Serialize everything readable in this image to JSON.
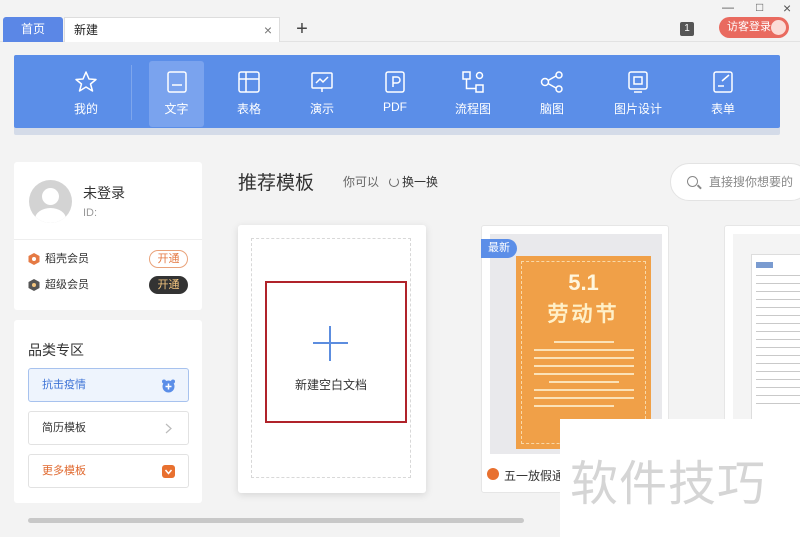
{
  "tabs": {
    "home": "首页",
    "new": "新建",
    "close": "×",
    "add": "+"
  },
  "top_right": {
    "badge": "1",
    "login": "访客登录",
    "minimize": "—",
    "maximize": "□",
    "close": "×"
  },
  "toolbar": [
    {
      "label": "我的",
      "icon": "star-icon"
    },
    {
      "label": "文字",
      "icon": "document-icon",
      "active": true
    },
    {
      "label": "表格",
      "icon": "table-icon"
    },
    {
      "label": "演示",
      "icon": "presentation-icon"
    },
    {
      "label": "PDF",
      "icon": "pdf-icon"
    },
    {
      "label": "流程图",
      "icon": "flowchart-icon"
    },
    {
      "label": "脑图",
      "icon": "mindmap-icon"
    },
    {
      "label": "图片设计",
      "icon": "image-design-icon"
    },
    {
      "label": "表单",
      "icon": "form-icon"
    }
  ],
  "user": {
    "name": "未登录",
    "id": "ID:",
    "memberships": [
      {
        "label": "稻壳会员",
        "button": "开通",
        "color": "#e57a44"
      },
      {
        "label": "超级会员",
        "button": "开通",
        "color": "#333333"
      }
    ]
  },
  "categories": {
    "title": "品类专区",
    "items": [
      "抗击疫情",
      "简历模板",
      "更多模板"
    ]
  },
  "section": {
    "title": "推荐模板",
    "subtitle": "你可以",
    "refresh": "换一换",
    "search_placeholder": "直接搜你想要的"
  },
  "blank_card": {
    "label": "新建空白文档"
  },
  "template": {
    "badge": "最新",
    "poster_number": "5.1",
    "poster_title": "劳动节",
    "name": "五一放假通"
  },
  "watermark": "软件技巧",
  "colors": {
    "accent": "#5b8ee8",
    "highlight_red": "#b0232a",
    "poster": "#f0a048"
  }
}
